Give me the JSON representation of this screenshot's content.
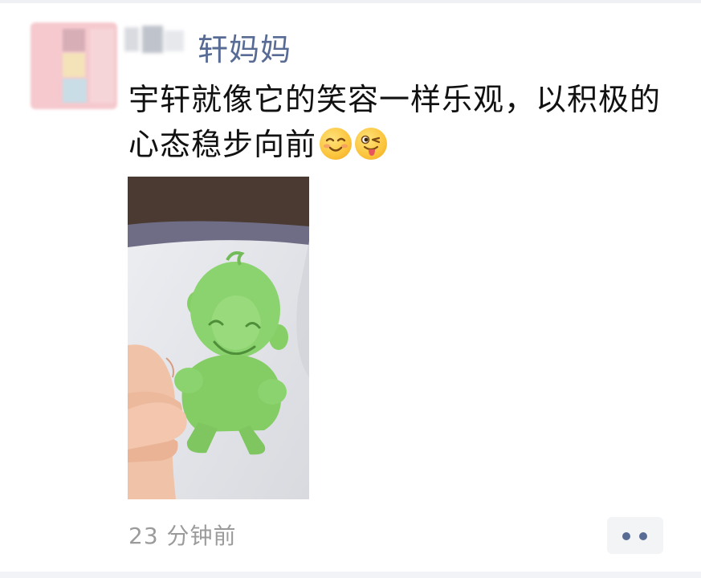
{
  "post": {
    "username": "轩妈妈",
    "text": "宇轩就像它的笑容一样乐观，以积极的心态稳步向前",
    "emojis": [
      "smiling-face-icon",
      "winking-tongue-face-icon"
    ],
    "timestamp": "23 分钟前",
    "more_icon": "more-dots-icon"
  },
  "colors": {
    "name_link": "#576b95",
    "body_text": "#111111",
    "timestamp": "#9b9b9b",
    "photo_toy": "#8bd36e"
  }
}
